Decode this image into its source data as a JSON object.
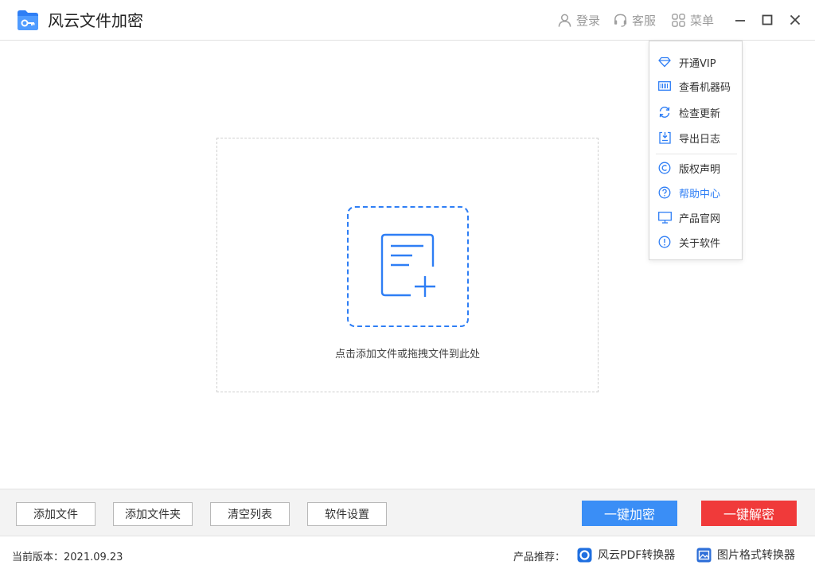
{
  "app": {
    "title": "风云文件加密"
  },
  "header": {
    "login_label": "登录",
    "service_label": "客服",
    "menu_label": "菜单"
  },
  "dropzone": {
    "hint": "点击添加文件或拖拽文件到此处"
  },
  "menu": {
    "items": [
      {
        "label": "开通VIP",
        "icon": "diamond-icon"
      },
      {
        "label": "查看机器码",
        "icon": "barcode-icon"
      },
      {
        "label": "检查更新",
        "icon": "refresh-icon"
      },
      {
        "label": "导出日志",
        "icon": "export-log-icon"
      },
      {
        "label": "版权声明",
        "icon": "copyright-icon"
      },
      {
        "label": "帮助中心",
        "icon": "help-icon"
      },
      {
        "label": "产品官网",
        "icon": "monitor-icon"
      },
      {
        "label": "关于软件",
        "icon": "info-icon"
      }
    ]
  },
  "toolbar": {
    "add_file": "添加文件",
    "add_folder": "添加文件夹",
    "clear_list": "清空列表",
    "settings": "软件设置",
    "encrypt": "一键加密",
    "decrypt": "一键解密"
  },
  "status": {
    "version": "当前版本：2021.09.23",
    "recommend_label": "产品推荐：",
    "rec_pdf": "风云PDF转换器",
    "rec_image": "图片格式转换器"
  },
  "colors": {
    "accent": "#2e7ef5",
    "encrypt_button": "#3a8ef6",
    "decrypt_button": "#f03a3a",
    "header_text": "#9a9a9a"
  }
}
